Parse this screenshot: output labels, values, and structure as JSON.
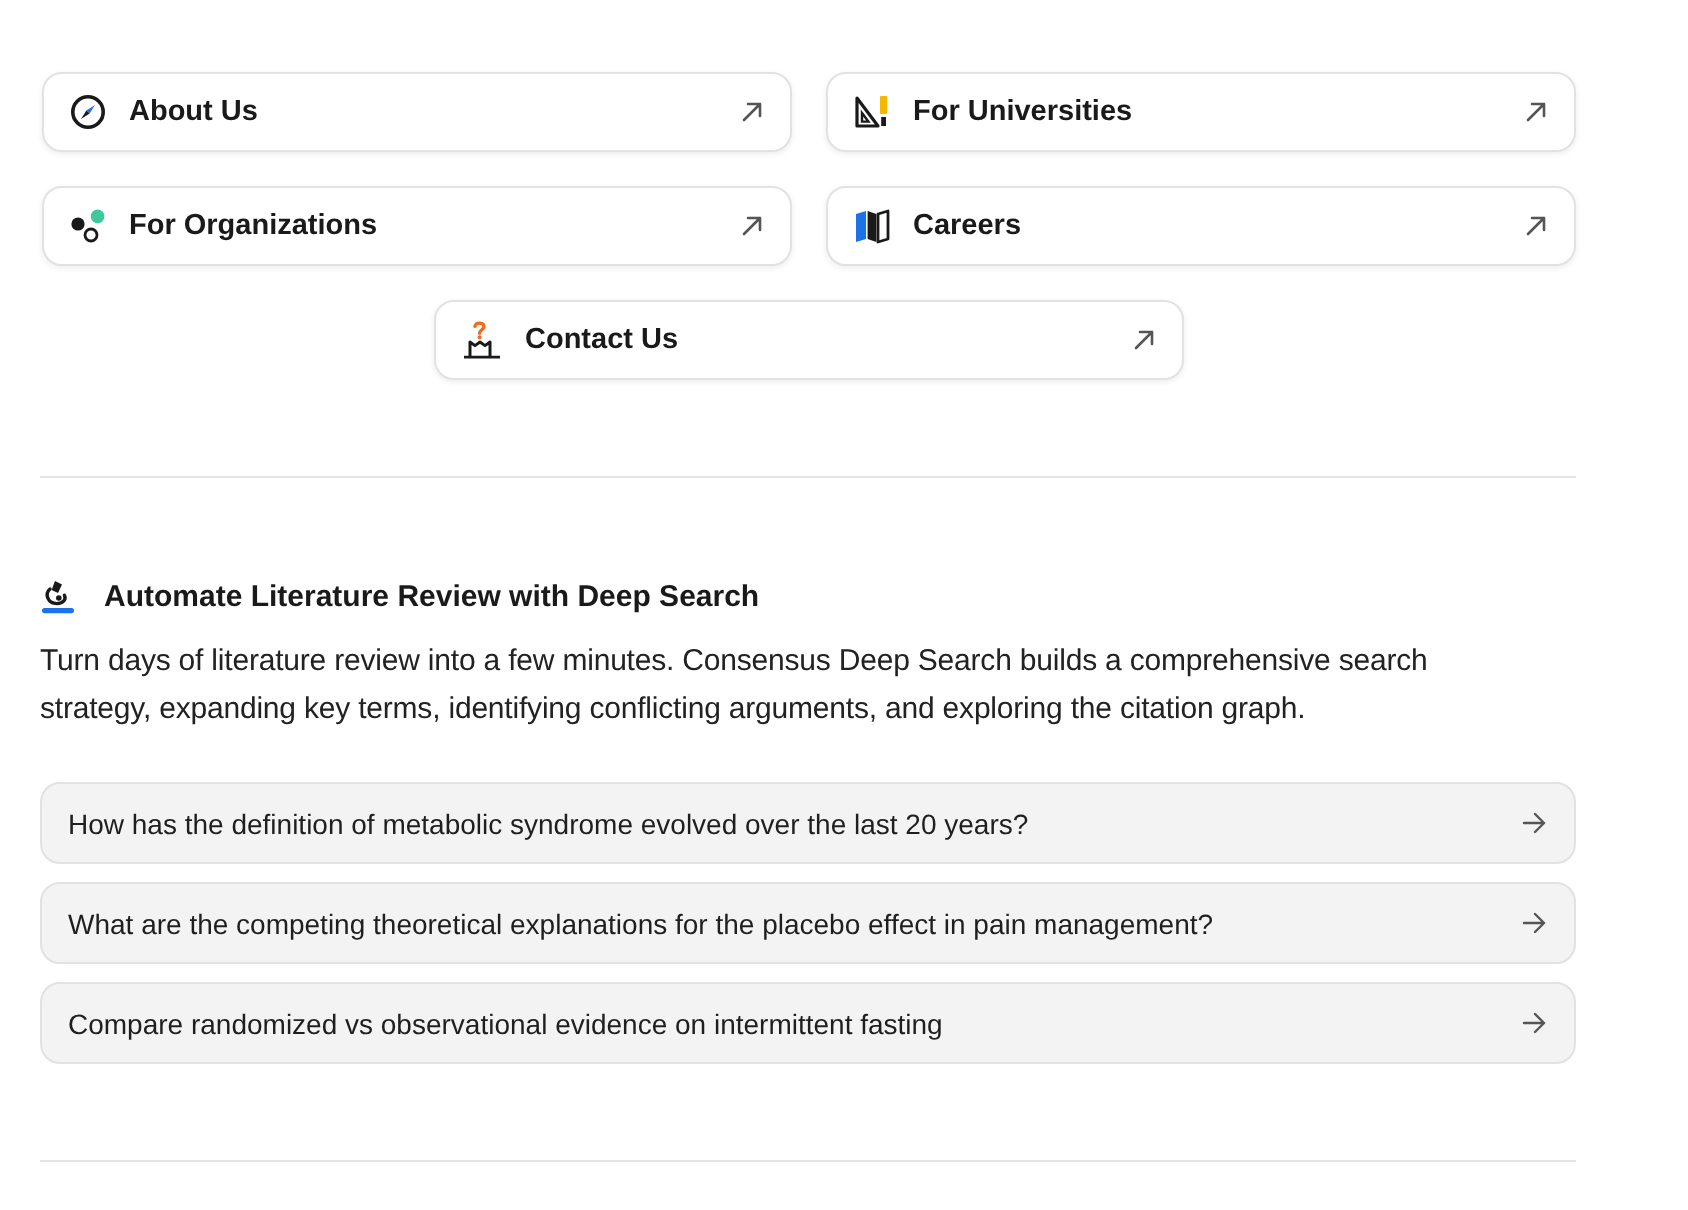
{
  "links": [
    {
      "label": "About Us"
    },
    {
      "label": "For Universities"
    },
    {
      "label": "For Organizations"
    },
    {
      "label": "Careers"
    },
    {
      "label": "Contact Us"
    }
  ],
  "deep_search": {
    "title": "Automate Literature Review with Deep Search",
    "description": "Turn days of literature review into a few minutes. Consensus Deep Search builds a comprehensive search strategy, expanding key terms, identifying conflicting arguments, and exploring the citation graph.",
    "prompts": [
      "How has the definition of metabolic syndrome evolved over the last 20 years?",
      "What are the competing theoretical explanations for the placebo effect in pain management?",
      "Compare randomized vs observational evidence on intermittent fasting"
    ]
  }
}
